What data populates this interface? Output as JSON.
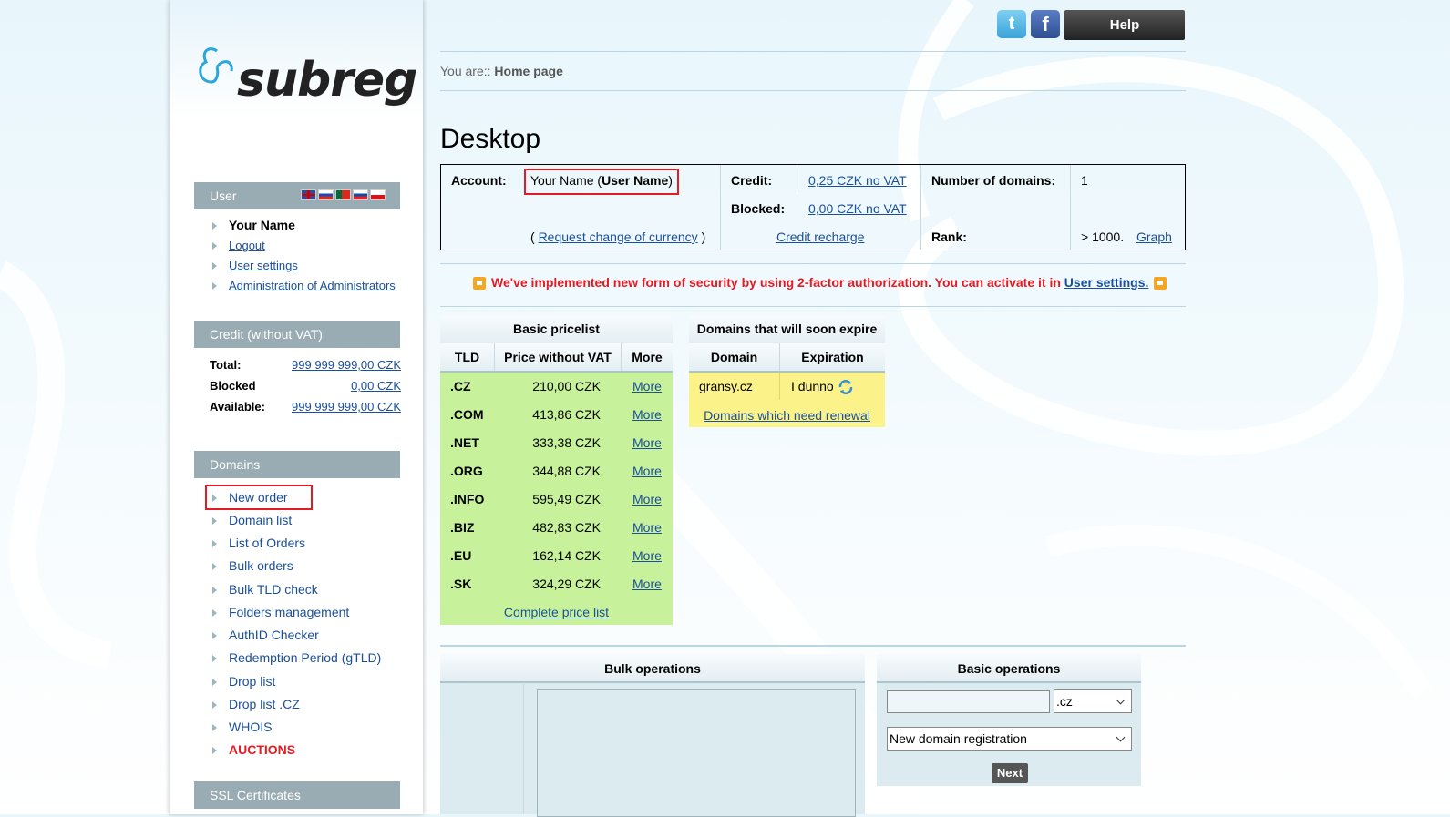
{
  "header": {
    "help_label": "Help",
    "breadcrumb_prefix": "You are::",
    "breadcrumb_current": "Home page",
    "page_title": "Desktop"
  },
  "logo": {
    "text": "subreg"
  },
  "user_section": {
    "heading": "User",
    "flags": [
      "gb-flag",
      "ru-flag",
      "pt-flag",
      "sk-flag",
      "cz-flag"
    ],
    "name": "Your Name",
    "links": [
      "Logout",
      "User settings",
      "Administration of Administrators"
    ]
  },
  "credit_section": {
    "heading": "Credit (without VAT)",
    "rows": [
      {
        "label": "Total:",
        "value": "999 999 999,00 CZK"
      },
      {
        "label": "Blocked",
        "value": "0,00 CZK"
      },
      {
        "label": "Available:",
        "value": "999 999 999,00 CZK"
      }
    ]
  },
  "domains_section": {
    "heading": "Domains",
    "items": [
      "New order",
      "Domain list",
      "List of Orders",
      "Bulk orders",
      "Bulk TLD check",
      "Folders management",
      "AuthID Checker",
      "Redemption Period (gTLD)",
      "Drop list",
      "Drop list .CZ",
      "WHOIS",
      "AUCTIONS"
    ]
  },
  "ssl_section": {
    "heading": "SSL Certificates"
  },
  "account": {
    "account_label": "Account:",
    "account_name": "Your Name (",
    "account_username": "User Name",
    "account_close": ")",
    "currency_prefix": "(",
    "currency_link": "Request change of currency",
    "currency_suffix": ")",
    "credit_label": "Credit:",
    "credit_value": "0,25 CZK no VAT",
    "blocked_label": "Blocked:",
    "blocked_value": "0,00 CZK no VAT",
    "recharge_link": "Credit recharge",
    "num_domains_label": "Number of domains:",
    "num_domains_value": "1",
    "rank_label": "Rank:",
    "rank_value": "> 1000.",
    "graph_link": "Graph"
  },
  "notice": {
    "text": "We've implemented new form of security by using 2-factor authorization. You can activate it in",
    "link": "User settings."
  },
  "pricelist": {
    "title": "Basic pricelist",
    "columns": [
      "TLD",
      "Price without VAT",
      "More"
    ],
    "rows": [
      {
        "tld": ".CZ",
        "price": "210,00 CZK",
        "more": "More"
      },
      {
        "tld": ".COM",
        "price": "413,86 CZK",
        "more": "More"
      },
      {
        "tld": ".NET",
        "price": "333,38 CZK",
        "more": "More"
      },
      {
        "tld": ".ORG",
        "price": "344,88 CZK",
        "more": "More"
      },
      {
        "tld": ".INFO",
        "price": "595,49 CZK",
        "more": "More"
      },
      {
        "tld": ".BIZ",
        "price": "482,83 CZK",
        "more": "More"
      },
      {
        "tld": ".EU",
        "price": "162,14 CZK",
        "more": "More"
      },
      {
        "tld": ".SK",
        "price": "324,29 CZK",
        "more": "More"
      }
    ],
    "footer_link": "Complete price list"
  },
  "expiring": {
    "title": "Domains that will soon expire",
    "columns": [
      "Domain",
      "Expiration"
    ],
    "rows": [
      {
        "domain": "gransy.cz",
        "expiration": "I dunno"
      }
    ],
    "footer_link": "Domains which need renewal"
  },
  "bulk_ops": {
    "title": "Bulk operations"
  },
  "basic_ops": {
    "title": "Basic operations",
    "domain_input_value": "",
    "tld_selected": ".cz",
    "operation_selected": "New domain registration",
    "next_label": "Next"
  },
  "colors": {
    "accent_red": "#e31b23",
    "link_blue": "#1a4f9c",
    "sidebar_head": "#9aacb3",
    "pricelist_green": "#c7f29b",
    "expire_yellow": "#fbf28a"
  }
}
